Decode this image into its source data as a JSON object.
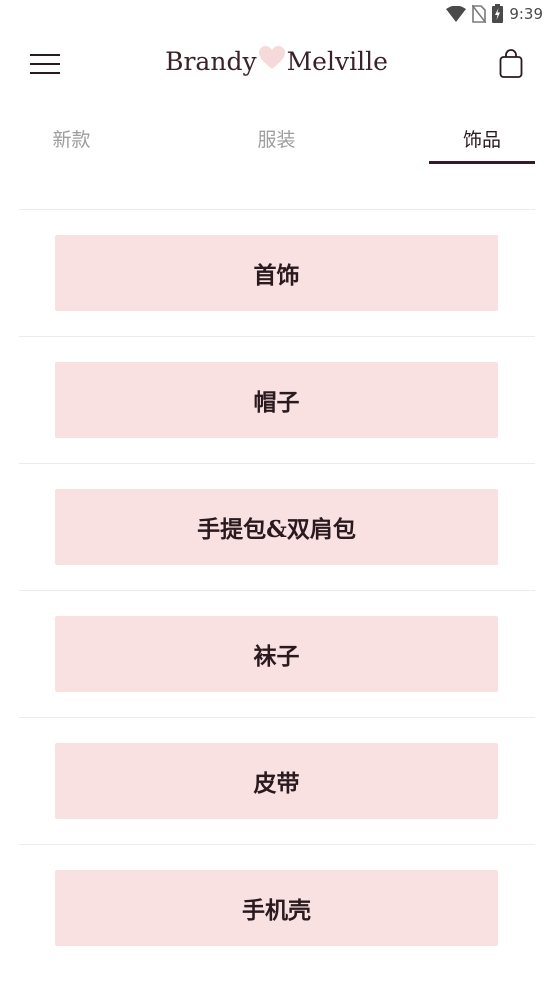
{
  "status_bar": {
    "time": "9:39",
    "icons": [
      "wifi-icon",
      "no-sim-icon",
      "battery-charging-icon"
    ]
  },
  "header": {
    "brand_left": "Brandy",
    "brand_right": "Melville",
    "menu_icon": "hamburger-menu-icon",
    "cart_icon": "shopping-bag-icon"
  },
  "tabs": [
    {
      "label": "新款",
      "active": false
    },
    {
      "label": "服装",
      "active": false
    },
    {
      "label": "饰品",
      "active": true
    }
  ],
  "categories": [
    {
      "label": "首饰"
    },
    {
      "label": "帽子"
    },
    {
      "label": "手提包&双肩包"
    },
    {
      "label": "袜子"
    },
    {
      "label": "皮带"
    },
    {
      "label": "手机壳"
    }
  ],
  "colors": {
    "accent": "#3a1a22",
    "button_bg": "#f8e1e0",
    "heart": "#f6d9d9",
    "inactive_tab": "#9e9e9e"
  }
}
